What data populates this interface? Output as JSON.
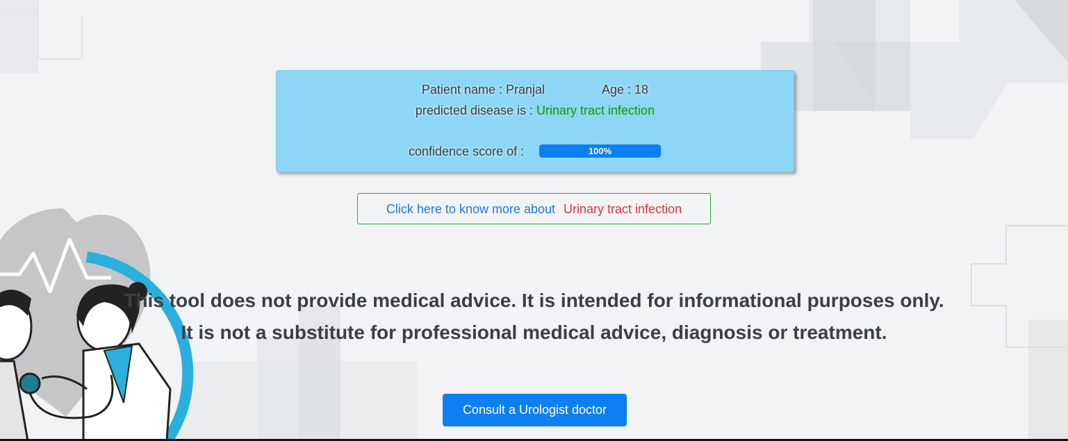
{
  "patient": {
    "name_label": "Patient name : Pranjal",
    "age_label": "Age : 18"
  },
  "prediction": {
    "prefix": "predicted disease is :",
    "disease": "Urinary tract infection"
  },
  "confidence": {
    "label": "confidence score of :",
    "value_text": "100%",
    "value": 1.0
  },
  "learn_more": {
    "lead": "Click here to know more about",
    "topic": "Urinary tract infection"
  },
  "disclaimer": {
    "line1": "This tool does not provide medical advice. It is intended for informational purposes only.",
    "line2": "It is not a substitute for professional medical advice, diagnosis or treatment."
  },
  "consult_button": "Consult a Urologist doctor",
  "colors": {
    "card_bg": "#8ed6f5",
    "progress": "#0d7ff0",
    "disease_text": "#1e8b3a",
    "link_blue": "#1e78e6",
    "topic_red": "#dc3545",
    "button_blue": "#0d7ff0"
  },
  "icons": {
    "illustration": "doctor-with-stethoscope-illustration",
    "heart": "heart-pulse-icon"
  }
}
